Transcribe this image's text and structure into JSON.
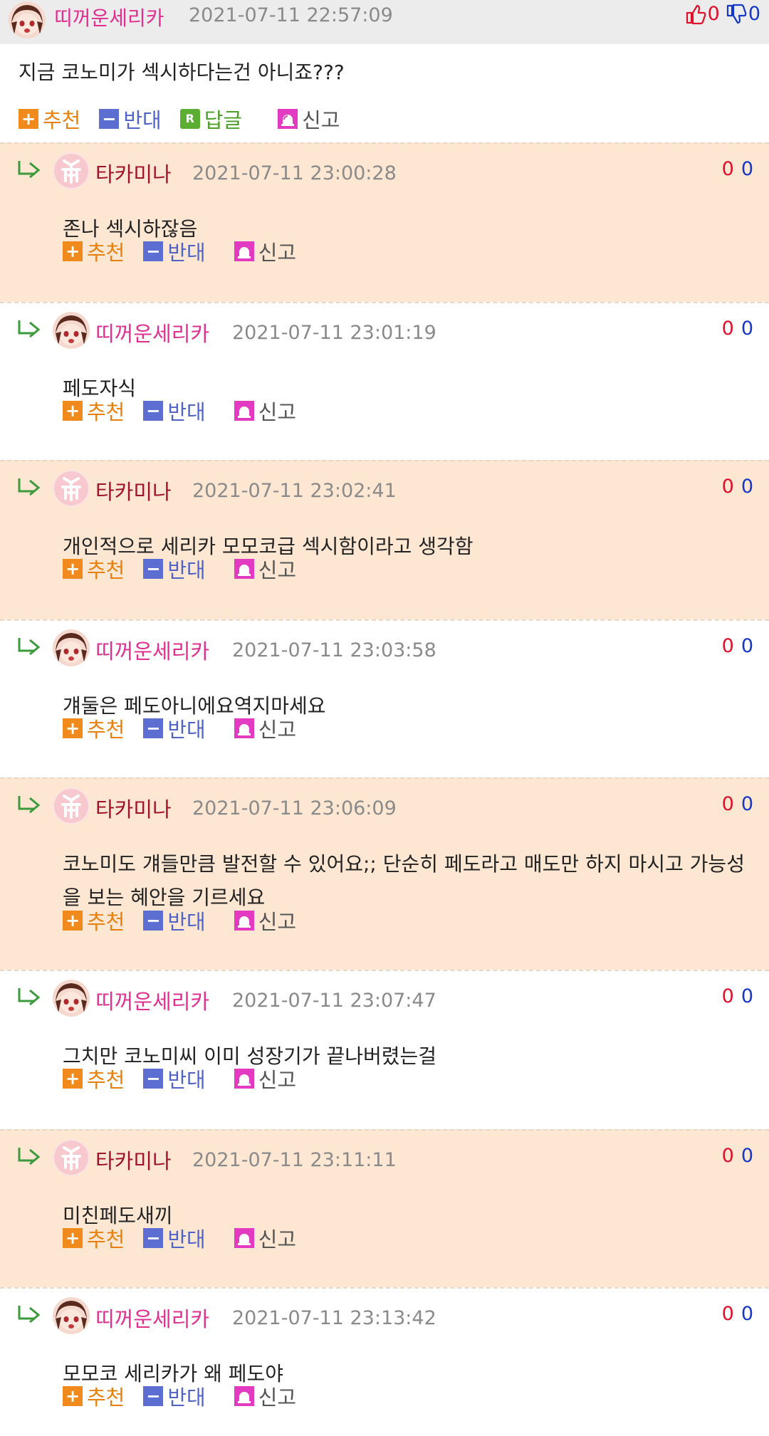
{
  "post": {
    "author": "띠꺼운세리카",
    "date": "2021-07-11 22:57:09",
    "up_votes": "0",
    "down_votes": "0",
    "text": "지금 코노미가 섹시하다는건 아니죠???",
    "actions": {
      "recommend": "추천",
      "oppose": "반대",
      "reply": "답글",
      "report": "신고"
    }
  },
  "comments": [
    {
      "author": "타카미나",
      "date": "2021-07-11 23:00:28",
      "up": "0",
      "down": "0",
      "text": "존나 섹시하잖음",
      "lines": 1,
      "style": "odd",
      "avatar": "takamina"
    },
    {
      "author": "띠꺼운세리카",
      "date": "2021-07-11 23:01:19",
      "up": "0",
      "down": "0",
      "text": "페도자식",
      "lines": 1,
      "style": "even",
      "avatar": "serika"
    },
    {
      "author": "타카미나",
      "date": "2021-07-11 23:02:41",
      "up": "0",
      "down": "0",
      "text": "개인적으로 세리카 모모코급 섹시함이라고 생각함",
      "lines": 1,
      "style": "odd",
      "avatar": "takamina"
    },
    {
      "author": "띠꺼운세리카",
      "date": "2021-07-11 23:03:58",
      "up": "0",
      "down": "0",
      "text": "걔둘은 페도아니에요역지마세요",
      "lines": 1,
      "style": "even",
      "avatar": "serika"
    },
    {
      "author": "타카미나",
      "date": "2021-07-11 23:06:09",
      "up": "0",
      "down": "0",
      "text": "코노미도 걔들만큼 발전할 수 있어요;; 단순히 페도라고 매도만 하지 마시고 가능성을 보는 혜안을 기르세요",
      "lines": 2,
      "style": "odd",
      "avatar": "takamina"
    },
    {
      "author": "띠꺼운세리카",
      "date": "2021-07-11 23:07:47",
      "up": "0",
      "down": "0",
      "text": "그치만 코노미씨 이미 성장기가 끝나버렸는걸",
      "lines": 1,
      "style": "even",
      "avatar": "serika"
    },
    {
      "author": "타카미나",
      "date": "2021-07-11 23:11:11",
      "up": "0",
      "down": "0",
      "text": "미친페도새끼",
      "lines": 1,
      "style": "odd",
      "avatar": "takamina"
    },
    {
      "author": "띠꺼운세리카",
      "date": "2021-07-11 23:13:42",
      "up": "0",
      "down": "0",
      "text": "모모코 세리카가 왜 페도야",
      "lines": 1,
      "style": "even",
      "avatar": "serika"
    }
  ],
  "comment_actions": {
    "recommend": "추천",
    "oppose": "반대",
    "report": "신고"
  },
  "colors": {
    "odd_bg": "#fde7d3",
    "even_bg": "#ffffff",
    "up": "#e0102a",
    "down": "#1638c9",
    "author_pink": "#e0308f",
    "author_red": "#a0122a"
  },
  "icons": {
    "thumbs_up": "thumbs-up-icon",
    "thumbs_down": "thumbs-down-icon",
    "reply_arrow": "reply-arrow-icon",
    "plus": "plus-icon",
    "minus": "minus-icon",
    "report": "siren-icon"
  }
}
